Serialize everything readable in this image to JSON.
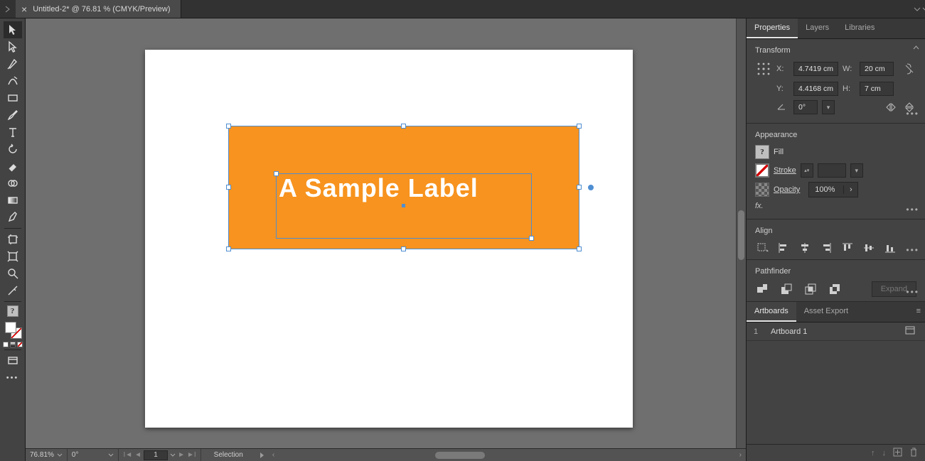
{
  "tabstrip": {
    "title": "Untitled-2* @ 76.81 % (CMYK/Preview)"
  },
  "canvas": {
    "label_text": "A Sample Label"
  },
  "statusbar": {
    "zoom": "76.81%",
    "rotation": "0°",
    "artboard_index": "1",
    "tool": "Selection"
  },
  "properties": {
    "tabs": [
      "Properties",
      "Layers",
      "Libraries"
    ],
    "transform": {
      "title": "Transform",
      "x_label": "X:",
      "x": "4.7419 cm",
      "y_label": "Y:",
      "y": "4.4168 cm",
      "w_label": "W:",
      "w": "20 cm",
      "h_label": "H:",
      "h": "7 cm",
      "angle": "0°"
    },
    "appearance": {
      "title": "Appearance",
      "fill_label": "Fill",
      "stroke_label": "Stroke",
      "opacity_label": "Opacity",
      "opacity_value": "100%",
      "fx": "fx."
    },
    "align": {
      "title": "Align"
    },
    "pathfinder": {
      "title": "Pathfinder",
      "expand": "Expand"
    }
  },
  "artboards": {
    "tabs": [
      "Artboards",
      "Asset Export"
    ],
    "items": [
      {
        "index": "1",
        "name": "Artboard 1"
      }
    ]
  }
}
